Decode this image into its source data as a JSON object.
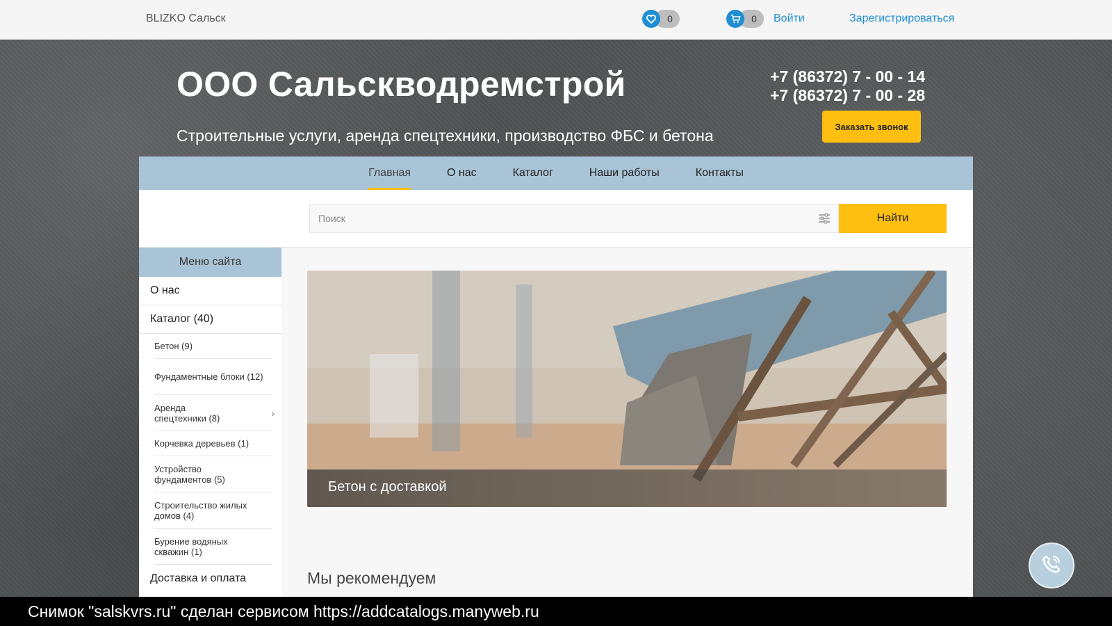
{
  "topbar": {
    "brand": "BLIZKO Сальск",
    "favorites_count": "0",
    "cart_count": "0",
    "login": "Войти",
    "register": "Зарегистрироваться",
    "accent": "#1f8ed3"
  },
  "header": {
    "title": "ООО Сальскводремстрой",
    "subtitle": "Строительные услуги, аренда спецтехники, производство ФБС и бетона",
    "phones": [
      "+7 (86372) 7 - 00 - 14",
      "+7 (86372) 7 - 00 - 28"
    ],
    "call_button": "Заказать звонок"
  },
  "nav": {
    "items": [
      "Главная",
      "О нас",
      "Каталог",
      "Наши работы",
      "Контакты"
    ],
    "active": "Главная"
  },
  "search": {
    "placeholder": "Поиск",
    "button": "Найти"
  },
  "sidebar": {
    "title": "Меню сайта",
    "about": "О нас",
    "catalog": "Каталог (40)",
    "sub_items": [
      "Бетон (9)",
      "Фундаментные блоки (12)",
      "Аренда спецтехники (8)",
      "Корчевка деревьев (1)",
      "Устройство фундаментов (5)",
      "Строительство жилых домов (4)",
      "Бурение водяных скважин (1)"
    ],
    "delivery": "Доставка и оплата"
  },
  "main": {
    "banner_caption": "Бетон с доставкой",
    "recommend_heading": "Мы рекомендуем"
  },
  "footer_caption": "Снимок \"salskvrs.ru\" сделан сервисом https://addcatalogs.manyweb.ru",
  "colors": {
    "accent_yellow": "#ffbf10",
    "nav_blue": "#a9c4d6"
  }
}
